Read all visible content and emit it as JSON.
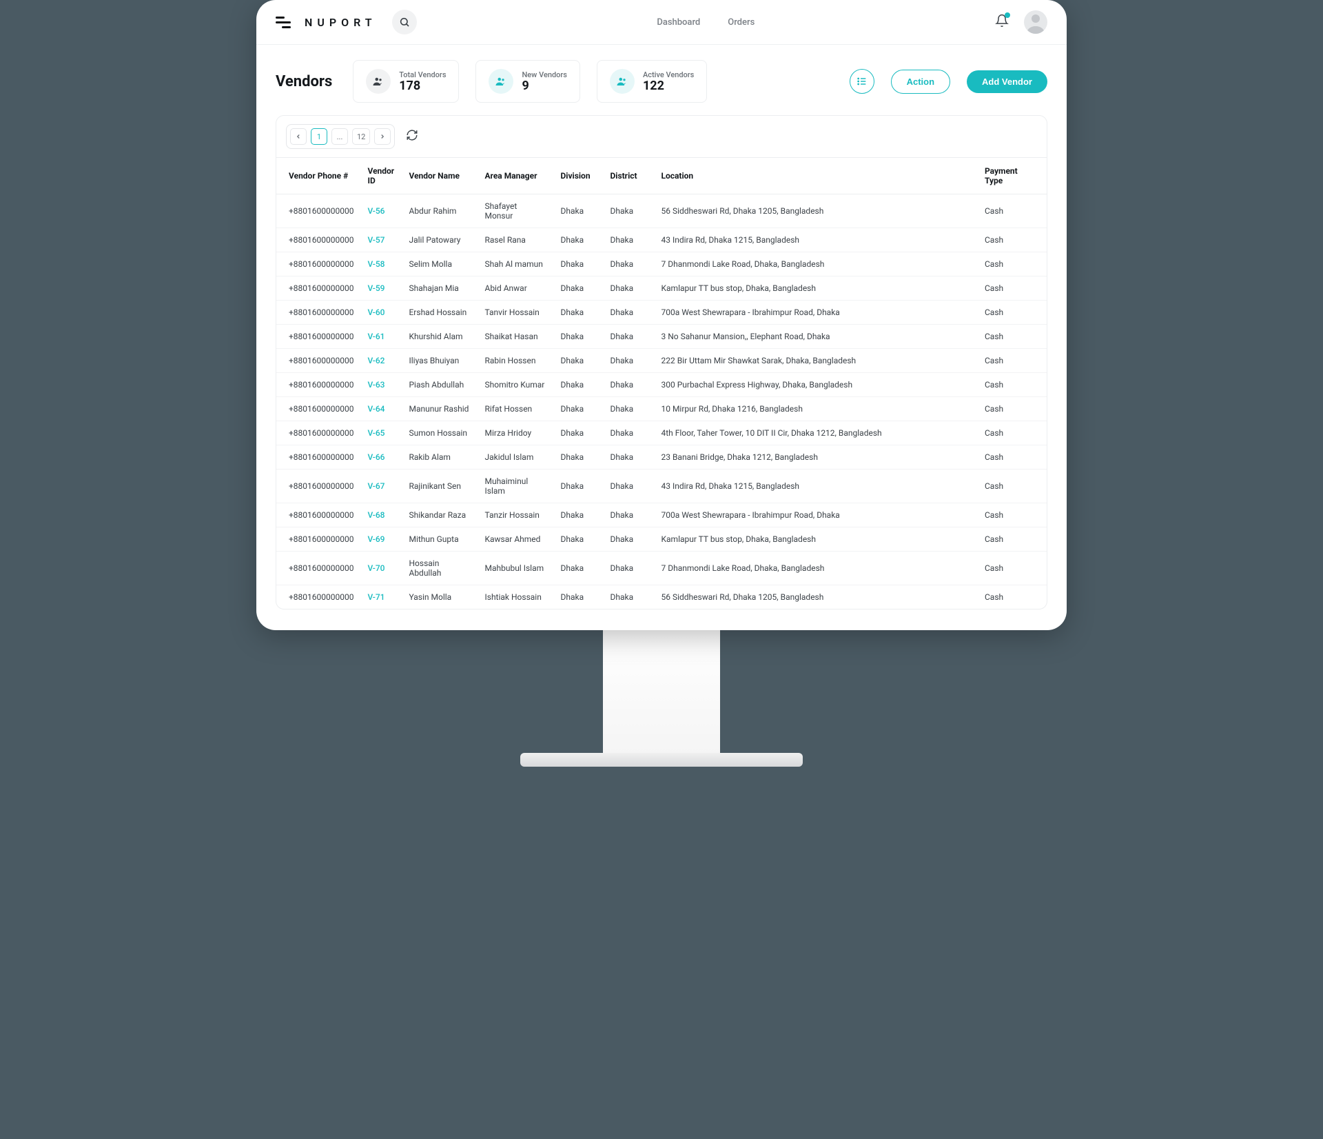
{
  "brand": "NUPORT",
  "nav": {
    "dashboard": "Dashboard",
    "orders": "Orders"
  },
  "page_title": "Vendors",
  "stats": {
    "total": {
      "label": "Total Vendors",
      "value": "178"
    },
    "new": {
      "label": "New Vendors",
      "value": "9"
    },
    "active": {
      "label": "Active Vendors",
      "value": "122"
    }
  },
  "buttons": {
    "action": "Action",
    "add": "Add Vendor"
  },
  "pagination": {
    "current": "1",
    "ellipsis": "...",
    "last": "12"
  },
  "columns": {
    "phone": "Vendor Phone #",
    "id": "Vendor ID",
    "name": "Vendor Name",
    "mgr": "Area Manager",
    "div": "Division",
    "dist": "District",
    "loc": "Location",
    "pay": "Payment Type"
  },
  "rows": [
    {
      "phone": "+8801600000000",
      "id": "V-56",
      "name": "Abdur Rahim",
      "mgr": "Shafayet Monsur",
      "div": "Dhaka",
      "dist": "Dhaka",
      "loc": "56 Siddheswari Rd, Dhaka 1205, Bangladesh",
      "pay": "Cash"
    },
    {
      "phone": "+8801600000000",
      "id": "V-57",
      "name": "Jalil Patowary",
      "mgr": "Rasel Rana",
      "div": "Dhaka",
      "dist": "Dhaka",
      "loc": "43 Indira Rd, Dhaka 1215, Bangladesh",
      "pay": "Cash"
    },
    {
      "phone": "+8801600000000",
      "id": "V-58",
      "name": "Selim Molla",
      "mgr": "Shah Al mamun",
      "div": "Dhaka",
      "dist": "Dhaka",
      "loc": "7 Dhanmondi Lake Road, Dhaka, Bangladesh",
      "pay": "Cash"
    },
    {
      "phone": "+8801600000000",
      "id": "V-59",
      "name": "Shahajan Mia",
      "mgr": "Abid Anwar",
      "div": "Dhaka",
      "dist": "Dhaka",
      "loc": "Kamlapur TT bus stop, Dhaka, Bangladesh",
      "pay": "Cash"
    },
    {
      "phone": "+8801600000000",
      "id": "V-60",
      "name": "Ershad Hossain",
      "mgr": "Tanvir Hossain",
      "div": "Dhaka",
      "dist": "Dhaka",
      "loc": "700a West Shewrapara - Ibrahimpur Road, Dhaka",
      "pay": "Cash"
    },
    {
      "phone": "+8801600000000",
      "id": "V-61",
      "name": "Khurshid Alam",
      "mgr": "Shaikat Hasan",
      "div": "Dhaka",
      "dist": "Dhaka",
      "loc": "3 No Sahanur Mansion,, Elephant Road, Dhaka",
      "pay": "Cash"
    },
    {
      "phone": "+8801600000000",
      "id": "V-62",
      "name": "Iliyas Bhuiyan",
      "mgr": "Rabin Hossen",
      "div": "Dhaka",
      "dist": "Dhaka",
      "loc": "222 Bir Uttam Mir Shawkat Sarak, Dhaka, Bangladesh",
      "pay": "Cash"
    },
    {
      "phone": "+8801600000000",
      "id": "V-63",
      "name": "Piash Abdullah",
      "mgr": "Shomitro Kumar",
      "div": "Dhaka",
      "dist": "Dhaka",
      "loc": "300 Purbachal Express Highway, Dhaka, Bangladesh",
      "pay": "Cash"
    },
    {
      "phone": "+8801600000000",
      "id": "V-64",
      "name": "Manunur Rashid",
      "mgr": "Rifat Hossen",
      "div": "Dhaka",
      "dist": "Dhaka",
      "loc": "10 Mirpur Rd, Dhaka 1216, Bangladesh",
      "pay": "Cash"
    },
    {
      "phone": "+8801600000000",
      "id": "V-65",
      "name": "Sumon Hossain",
      "mgr": "Mirza Hridoy",
      "div": "Dhaka",
      "dist": "Dhaka",
      "loc": "4th Floor, Taher Tower, 10 DIT II Cir, Dhaka 1212, Bangladesh",
      "pay": "Cash"
    },
    {
      "phone": "+8801600000000",
      "id": "V-66",
      "name": "Rakib Alam",
      "mgr": "Jakidul Islam",
      "div": "Dhaka",
      "dist": "Dhaka",
      "loc": "23 Banani Bridge, Dhaka 1212, Bangladesh",
      "pay": "Cash"
    },
    {
      "phone": "+8801600000000",
      "id": "V-67",
      "name": "Rajinikant Sen",
      "mgr": "Muhaiminul Islam",
      "div": "Dhaka",
      "dist": "Dhaka",
      "loc": "43 Indira Rd, Dhaka 1215, Bangladesh",
      "pay": "Cash"
    },
    {
      "phone": "+8801600000000",
      "id": "V-68",
      "name": "Shikandar Raza",
      "mgr": "Tanzir Hossain",
      "div": "Dhaka",
      "dist": "Dhaka",
      "loc": "700a West Shewrapara - Ibrahimpur Road, Dhaka",
      "pay": "Cash"
    },
    {
      "phone": "+8801600000000",
      "id": "V-69",
      "name": "Mithun Gupta",
      "mgr": "Kawsar Ahmed",
      "div": "Dhaka",
      "dist": "Dhaka",
      "loc": "Kamlapur TT bus stop, Dhaka, Bangladesh",
      "pay": "Cash"
    },
    {
      "phone": "+8801600000000",
      "id": "V-70",
      "name": "Hossain Abdullah",
      "mgr": "Mahbubul Islam",
      "div": "Dhaka",
      "dist": "Dhaka",
      "loc": "7 Dhanmondi Lake Road, Dhaka, Bangladesh",
      "pay": "Cash"
    },
    {
      "phone": "+8801600000000",
      "id": "V-71",
      "name": "Yasin Molla",
      "mgr": "Ishtiak Hossain",
      "div": "Dhaka",
      "dist": "Dhaka",
      "loc": "56 Siddheswari Rd, Dhaka 1205, Bangladesh",
      "pay": "Cash"
    }
  ]
}
